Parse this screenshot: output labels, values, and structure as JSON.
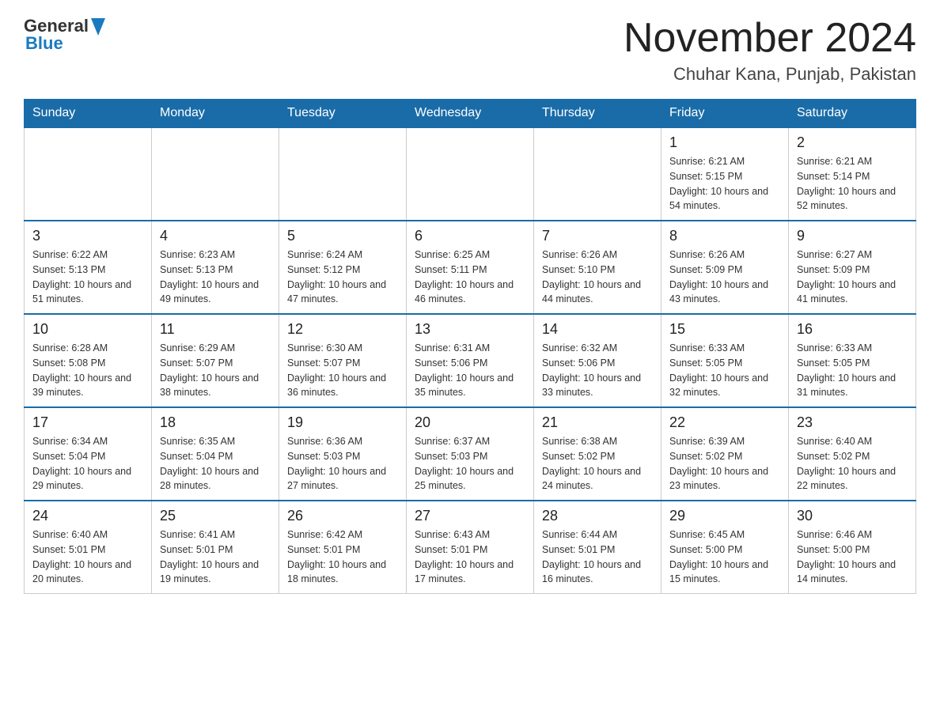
{
  "header": {
    "logo": {
      "general": "General",
      "blue": "Blue"
    },
    "title": "November 2024",
    "location": "Chuhar Kana, Punjab, Pakistan"
  },
  "days_of_week": [
    "Sunday",
    "Monday",
    "Tuesday",
    "Wednesday",
    "Thursday",
    "Friday",
    "Saturday"
  ],
  "weeks": [
    [
      {
        "day": "",
        "info": ""
      },
      {
        "day": "",
        "info": ""
      },
      {
        "day": "",
        "info": ""
      },
      {
        "day": "",
        "info": ""
      },
      {
        "day": "",
        "info": ""
      },
      {
        "day": "1",
        "info": "Sunrise: 6:21 AM\nSunset: 5:15 PM\nDaylight: 10 hours and 54 minutes."
      },
      {
        "day": "2",
        "info": "Sunrise: 6:21 AM\nSunset: 5:14 PM\nDaylight: 10 hours and 52 minutes."
      }
    ],
    [
      {
        "day": "3",
        "info": "Sunrise: 6:22 AM\nSunset: 5:13 PM\nDaylight: 10 hours and 51 minutes."
      },
      {
        "day": "4",
        "info": "Sunrise: 6:23 AM\nSunset: 5:13 PM\nDaylight: 10 hours and 49 minutes."
      },
      {
        "day": "5",
        "info": "Sunrise: 6:24 AM\nSunset: 5:12 PM\nDaylight: 10 hours and 47 minutes."
      },
      {
        "day": "6",
        "info": "Sunrise: 6:25 AM\nSunset: 5:11 PM\nDaylight: 10 hours and 46 minutes."
      },
      {
        "day": "7",
        "info": "Sunrise: 6:26 AM\nSunset: 5:10 PM\nDaylight: 10 hours and 44 minutes."
      },
      {
        "day": "8",
        "info": "Sunrise: 6:26 AM\nSunset: 5:09 PM\nDaylight: 10 hours and 43 minutes."
      },
      {
        "day": "9",
        "info": "Sunrise: 6:27 AM\nSunset: 5:09 PM\nDaylight: 10 hours and 41 minutes."
      }
    ],
    [
      {
        "day": "10",
        "info": "Sunrise: 6:28 AM\nSunset: 5:08 PM\nDaylight: 10 hours and 39 minutes."
      },
      {
        "day": "11",
        "info": "Sunrise: 6:29 AM\nSunset: 5:07 PM\nDaylight: 10 hours and 38 minutes."
      },
      {
        "day": "12",
        "info": "Sunrise: 6:30 AM\nSunset: 5:07 PM\nDaylight: 10 hours and 36 minutes."
      },
      {
        "day": "13",
        "info": "Sunrise: 6:31 AM\nSunset: 5:06 PM\nDaylight: 10 hours and 35 minutes."
      },
      {
        "day": "14",
        "info": "Sunrise: 6:32 AM\nSunset: 5:06 PM\nDaylight: 10 hours and 33 minutes."
      },
      {
        "day": "15",
        "info": "Sunrise: 6:33 AM\nSunset: 5:05 PM\nDaylight: 10 hours and 32 minutes."
      },
      {
        "day": "16",
        "info": "Sunrise: 6:33 AM\nSunset: 5:05 PM\nDaylight: 10 hours and 31 minutes."
      }
    ],
    [
      {
        "day": "17",
        "info": "Sunrise: 6:34 AM\nSunset: 5:04 PM\nDaylight: 10 hours and 29 minutes."
      },
      {
        "day": "18",
        "info": "Sunrise: 6:35 AM\nSunset: 5:04 PM\nDaylight: 10 hours and 28 minutes."
      },
      {
        "day": "19",
        "info": "Sunrise: 6:36 AM\nSunset: 5:03 PM\nDaylight: 10 hours and 27 minutes."
      },
      {
        "day": "20",
        "info": "Sunrise: 6:37 AM\nSunset: 5:03 PM\nDaylight: 10 hours and 25 minutes."
      },
      {
        "day": "21",
        "info": "Sunrise: 6:38 AM\nSunset: 5:02 PM\nDaylight: 10 hours and 24 minutes."
      },
      {
        "day": "22",
        "info": "Sunrise: 6:39 AM\nSunset: 5:02 PM\nDaylight: 10 hours and 23 minutes."
      },
      {
        "day": "23",
        "info": "Sunrise: 6:40 AM\nSunset: 5:02 PM\nDaylight: 10 hours and 22 minutes."
      }
    ],
    [
      {
        "day": "24",
        "info": "Sunrise: 6:40 AM\nSunset: 5:01 PM\nDaylight: 10 hours and 20 minutes."
      },
      {
        "day": "25",
        "info": "Sunrise: 6:41 AM\nSunset: 5:01 PM\nDaylight: 10 hours and 19 minutes."
      },
      {
        "day": "26",
        "info": "Sunrise: 6:42 AM\nSunset: 5:01 PM\nDaylight: 10 hours and 18 minutes."
      },
      {
        "day": "27",
        "info": "Sunrise: 6:43 AM\nSunset: 5:01 PM\nDaylight: 10 hours and 17 minutes."
      },
      {
        "day": "28",
        "info": "Sunrise: 6:44 AM\nSunset: 5:01 PM\nDaylight: 10 hours and 16 minutes."
      },
      {
        "day": "29",
        "info": "Sunrise: 6:45 AM\nSunset: 5:00 PM\nDaylight: 10 hours and 15 minutes."
      },
      {
        "day": "30",
        "info": "Sunrise: 6:46 AM\nSunset: 5:00 PM\nDaylight: 10 hours and 14 minutes."
      }
    ]
  ]
}
